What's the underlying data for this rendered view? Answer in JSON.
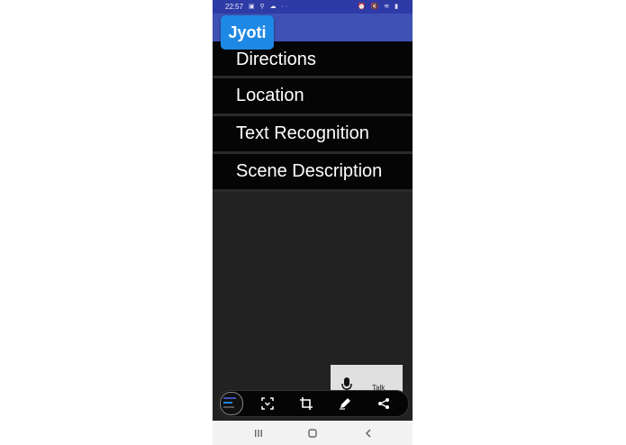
{
  "status_bar": {
    "time": "22:57",
    "left_icons": "▣ ⚲ ☁ ··",
    "right_icons": "⏰ 🔇 ≋ ▮"
  },
  "app": {
    "title": "Jyoti"
  },
  "menu": {
    "items": [
      {
        "label": "Directions"
      },
      {
        "label": "Location"
      },
      {
        "label": "Text Recognition"
      },
      {
        "label": "Scene Description"
      }
    ]
  },
  "talk_button": {
    "label": "Talk",
    "icon": "microphone-icon"
  },
  "screenshot_toolbar": {
    "icons": [
      "thumbnail",
      "scroll-capture-icon",
      "crop-icon",
      "pencil-icon",
      "share-icon"
    ]
  },
  "nav_bar": {
    "icons": [
      "recent-apps-icon",
      "home-icon",
      "back-icon"
    ]
  },
  "colors": {
    "app_bar": "#3f51b5",
    "status_bar": "#2e3aa6",
    "title_badge": "#1e88e5",
    "menu_item_bg": "#050505",
    "screen_bg": "#222222"
  }
}
